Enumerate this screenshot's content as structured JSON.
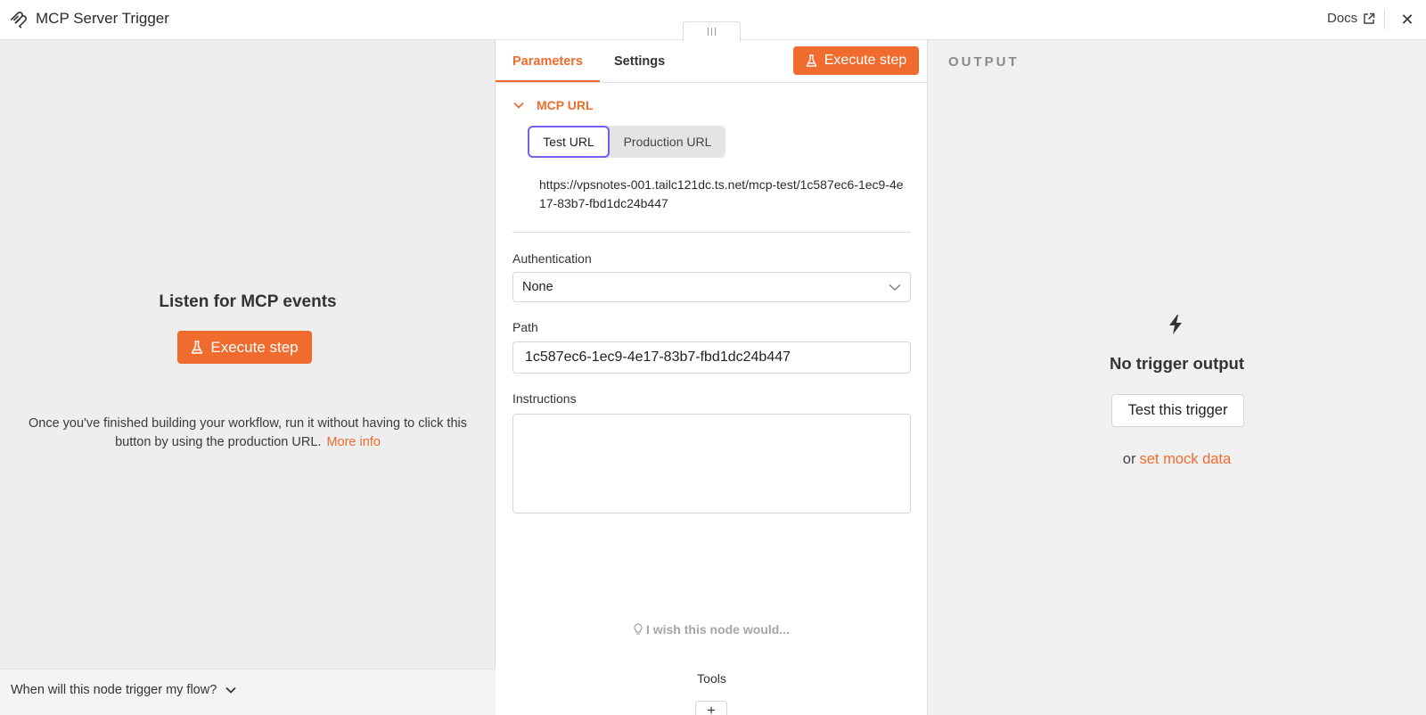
{
  "header": {
    "title": "MCP Server Trigger",
    "docs_label": "Docs",
    "close_glyph": "✕"
  },
  "left_panel": {
    "heading": "Listen for MCP events",
    "execute_label": "Execute step",
    "description": "Once you've finished building your workflow, run it without having to click this button by using the production URL.",
    "more_info_label": "More info",
    "footer_question": "When will this node trigger my flow?"
  },
  "tabs": {
    "parameters": "Parameters",
    "settings": "Settings",
    "active": "Parameters"
  },
  "parameters": {
    "execute_label": "Execute step",
    "mcp_url": {
      "section_label": "MCP URL",
      "options": [
        "Test URL",
        "Production URL"
      ],
      "selected": "Test URL",
      "url": "https://vpsnotes-001.tailc121dc.ts.net/mcp-test/1c587ec6-1ec9-4e17-83b7-fbd1dc24b447"
    },
    "authentication": {
      "label": "Authentication",
      "value": "None"
    },
    "path": {
      "label": "Path",
      "value": "1c587ec6-1ec9-4e17-83b7-fbd1dc24b447"
    },
    "instructions": {
      "label": "Instructions",
      "value": ""
    },
    "feedback_label": "I wish this node would...",
    "tools_label": "Tools",
    "add_glyph": "+"
  },
  "output": {
    "title": "OUTPUT",
    "empty_message": "No trigger output",
    "test_button_label": "Test this trigger",
    "or_label": "or",
    "mock_link_label": "set mock data"
  },
  "colors": {
    "accent": "#f06b2e",
    "focus_ring": "#7b5cf0",
    "left_panel_bg": "#eeeeee",
    "output_panel_bg": "#f0f0f0"
  }
}
